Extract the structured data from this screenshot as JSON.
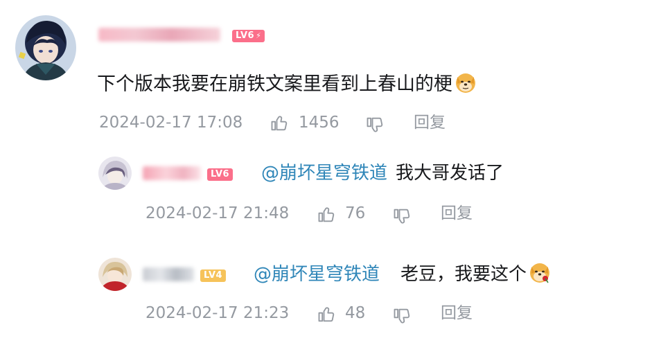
{
  "comment": {
    "level": "LV6",
    "content": "下个版本我要在崩铁文案里看到上春山的梗",
    "emoji": "doge-emoji",
    "timestamp": "2024-02-17 17:08",
    "likes": "1456",
    "reply_label": "回复"
  },
  "replies": [
    {
      "level": "LV6",
      "mention": "@崩坏星穹铁道",
      "content": "我大哥发话了",
      "timestamp": "2024-02-17 21:48",
      "likes": "76",
      "reply_label": "回复"
    },
    {
      "level": "LV4",
      "mention": "@崩坏星穹铁道",
      "content": "老豆，我要这个",
      "emoji": "doge-rose-emoji",
      "timestamp": "2024-02-17 21:23",
      "likes": "48",
      "reply_label": "回复"
    }
  ],
  "colors": {
    "mention": "#2f86b8",
    "meta": "#9499a0",
    "lv6": "#fb6f8a",
    "lv4": "#f6c35a"
  }
}
